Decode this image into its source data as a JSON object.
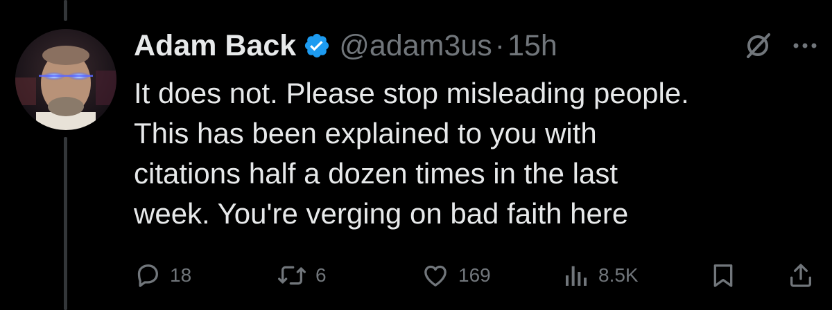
{
  "tweet": {
    "display_name": "Adam Back",
    "handle": "@adam3us",
    "separator": "·",
    "time": "15h",
    "text_lines": [
      "It does not. Please stop misleading people.",
      "This has been explained to you with",
      "citations half a dozen times in the last",
      "week. You're verging on bad faith here"
    ]
  },
  "metrics": {
    "replies": "18",
    "reposts": "6",
    "likes": "169",
    "views": "8.5K"
  },
  "icons": {
    "verified": "verified-badge-icon",
    "grok": "no-sign-icon",
    "more": "more-dots-icon",
    "reply": "reply-icon",
    "repost": "repost-icon",
    "like": "heart-icon",
    "views": "views-bar-chart-icon",
    "bookmark": "bookmark-icon",
    "share": "share-icon"
  },
  "colors": {
    "background": "#000000",
    "text": "#e7e9ea",
    "muted": "#71767b",
    "verified": "#1d9bf0",
    "thread_line": "#333639"
  }
}
